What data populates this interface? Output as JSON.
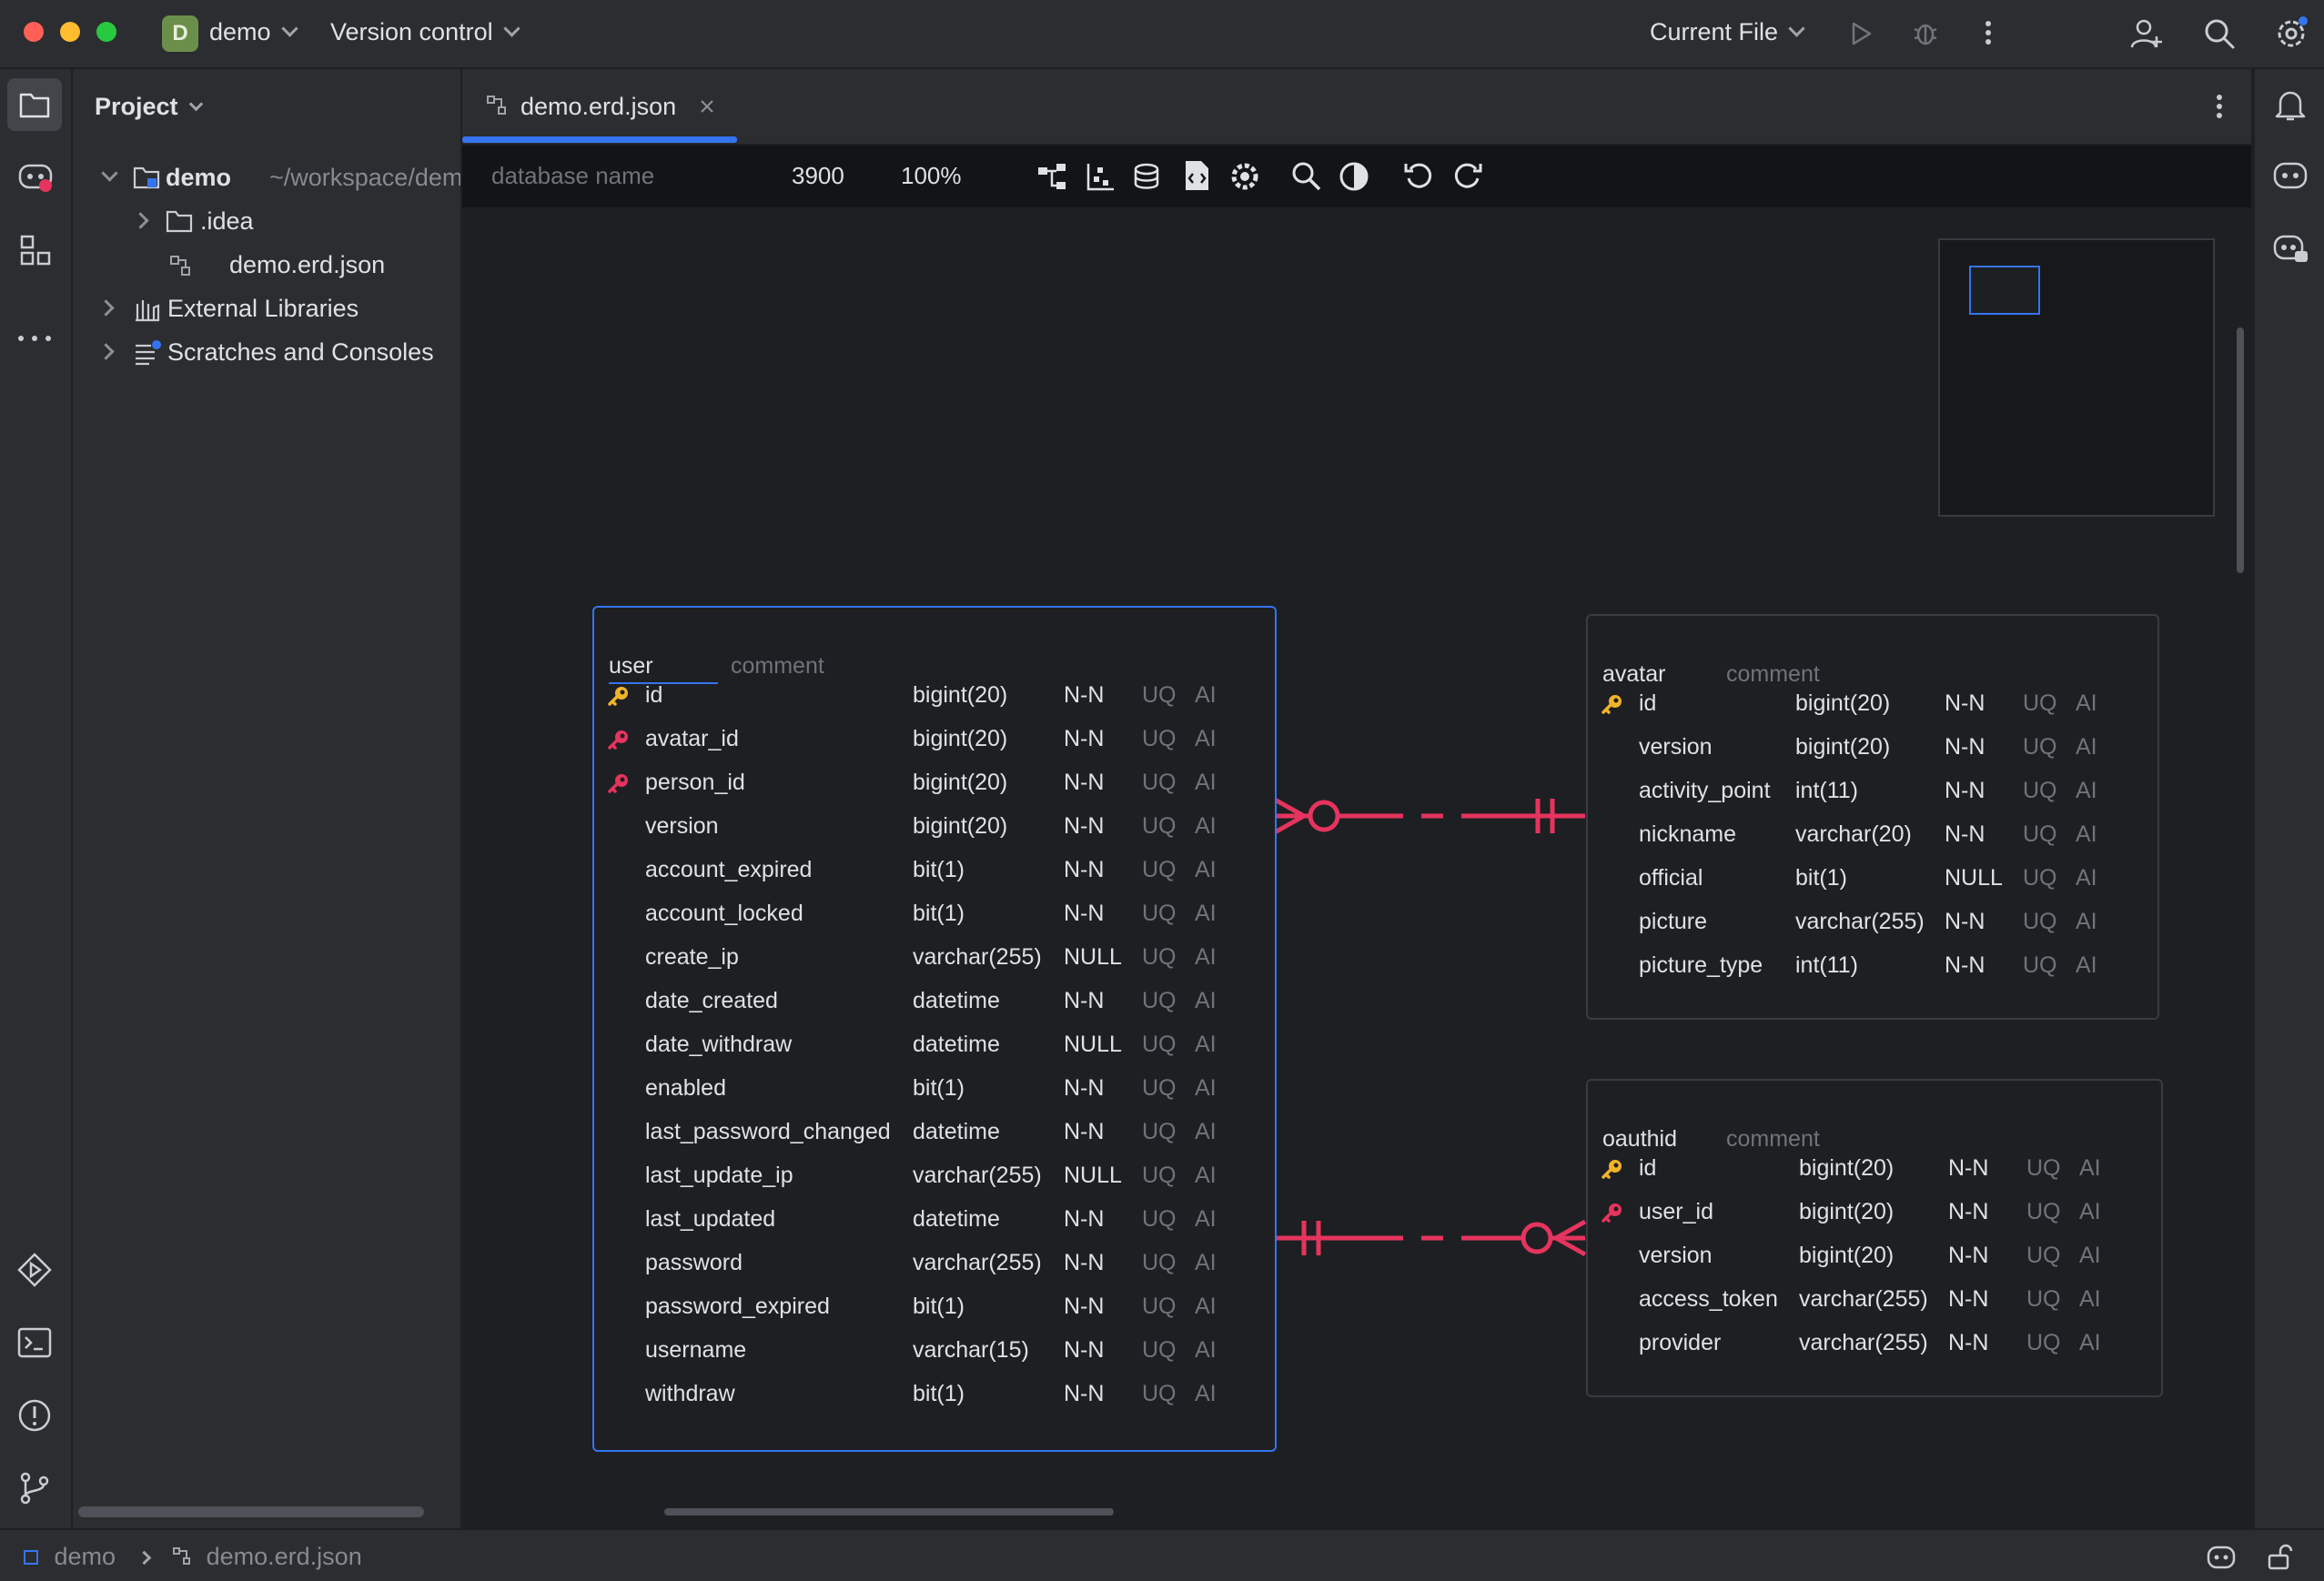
{
  "titlebar": {
    "project_badge": "D",
    "project_name": "demo",
    "version_control": "Version control",
    "run_config": "Current File"
  },
  "project_panel": {
    "title": "Project",
    "tree": [
      {
        "label": "demo",
        "path": "~/workspace/demo"
      },
      {
        "label": ".idea"
      },
      {
        "label": "demo.erd.json"
      },
      {
        "label": "External Libraries"
      },
      {
        "label": "Scratches and Consoles"
      }
    ]
  },
  "editor": {
    "tab_label": "demo.erd.json",
    "toolbar": {
      "db_placeholder": "database name",
      "canvas_size": "3900",
      "zoom": "100%"
    }
  },
  "tables": [
    {
      "name": "user",
      "comment": "comment",
      "columns": [
        {
          "name": "id",
          "type": "bigint(20)",
          "null": "N-N",
          "uq": "UQ",
          "ai": "AI",
          "key": "primary"
        },
        {
          "name": "avatar_id",
          "type": "bigint(20)",
          "null": "N-N",
          "uq": "UQ",
          "ai": "AI",
          "key": "foreign"
        },
        {
          "name": "person_id",
          "type": "bigint(20)",
          "null": "N-N",
          "uq": "UQ",
          "ai": "AI",
          "key": "foreign"
        },
        {
          "name": "version",
          "type": "bigint(20)",
          "null": "N-N",
          "uq": "UQ",
          "ai": "AI"
        },
        {
          "name": "account_expired",
          "type": "bit(1)",
          "null": "N-N",
          "uq": "UQ",
          "ai": "AI"
        },
        {
          "name": "account_locked",
          "type": "bit(1)",
          "null": "N-N",
          "uq": "UQ",
          "ai": "AI"
        },
        {
          "name": "create_ip",
          "type": "varchar(255)",
          "null": "NULL",
          "uq": "UQ",
          "ai": "AI"
        },
        {
          "name": "date_created",
          "type": "datetime",
          "null": "N-N",
          "uq": "UQ",
          "ai": "AI"
        },
        {
          "name": "date_withdraw",
          "type": "datetime",
          "null": "NULL",
          "uq": "UQ",
          "ai": "AI"
        },
        {
          "name": "enabled",
          "type": "bit(1)",
          "null": "N-N",
          "uq": "UQ",
          "ai": "AI"
        },
        {
          "name": "last_password_changed",
          "type": "datetime",
          "null": "N-N",
          "uq": "UQ",
          "ai": "AI"
        },
        {
          "name": "last_update_ip",
          "type": "varchar(255)",
          "null": "NULL",
          "uq": "UQ",
          "ai": "AI"
        },
        {
          "name": "last_updated",
          "type": "datetime",
          "null": "N-N",
          "uq": "UQ",
          "ai": "AI"
        },
        {
          "name": "password",
          "type": "varchar(255)",
          "null": "N-N",
          "uq": "UQ",
          "ai": "AI"
        },
        {
          "name": "password_expired",
          "type": "bit(1)",
          "null": "N-N",
          "uq": "UQ",
          "ai": "AI"
        },
        {
          "name": "username",
          "type": "varchar(15)",
          "null": "N-N",
          "uq": "UQ",
          "ai": "AI"
        },
        {
          "name": "withdraw",
          "type": "bit(1)",
          "null": "N-N",
          "uq": "UQ",
          "ai": "AI"
        }
      ]
    },
    {
      "name": "avatar",
      "comment": "comment",
      "columns": [
        {
          "name": "id",
          "type": "bigint(20)",
          "null": "N-N",
          "uq": "UQ",
          "ai": "AI",
          "key": "primary"
        },
        {
          "name": "version",
          "type": "bigint(20)",
          "null": "N-N",
          "uq": "UQ",
          "ai": "AI"
        },
        {
          "name": "activity_point",
          "type": "int(11)",
          "null": "N-N",
          "uq": "UQ",
          "ai": "AI"
        },
        {
          "name": "nickname",
          "type": "varchar(20)",
          "null": "N-N",
          "uq": "UQ",
          "ai": "AI"
        },
        {
          "name": "official",
          "type": "bit(1)",
          "null": "NULL",
          "uq": "UQ",
          "ai": "AI"
        },
        {
          "name": "picture",
          "type": "varchar(255)",
          "null": "N-N",
          "uq": "UQ",
          "ai": "AI"
        },
        {
          "name": "picture_type",
          "type": "int(11)",
          "null": "N-N",
          "uq": "UQ",
          "ai": "AI"
        }
      ]
    },
    {
      "name": "oauthid",
      "comment": "comment",
      "columns": [
        {
          "name": "id",
          "type": "bigint(20)",
          "null": "N-N",
          "uq": "UQ",
          "ai": "AI",
          "key": "primary"
        },
        {
          "name": "user_id",
          "type": "bigint(20)",
          "null": "N-N",
          "uq": "UQ",
          "ai": "AI",
          "key": "foreign"
        },
        {
          "name": "version",
          "type": "bigint(20)",
          "null": "N-N",
          "uq": "UQ",
          "ai": "AI"
        },
        {
          "name": "access_token",
          "type": "varchar(255)",
          "null": "N-N",
          "uq": "UQ",
          "ai": "AI"
        },
        {
          "name": "provider",
          "type": "varchar(255)",
          "null": "N-N",
          "uq": "UQ",
          "ai": "AI"
        }
      ]
    }
  ],
  "statusbar": {
    "crumb_project": "demo",
    "crumb_file": "demo.erd.json"
  },
  "colors": {
    "primary_key": "#f0b429",
    "foreign_key": "#e5345e",
    "relation_line": "#e5345e",
    "selection": "#3574f0",
    "accent_tab": "#3574f0"
  }
}
